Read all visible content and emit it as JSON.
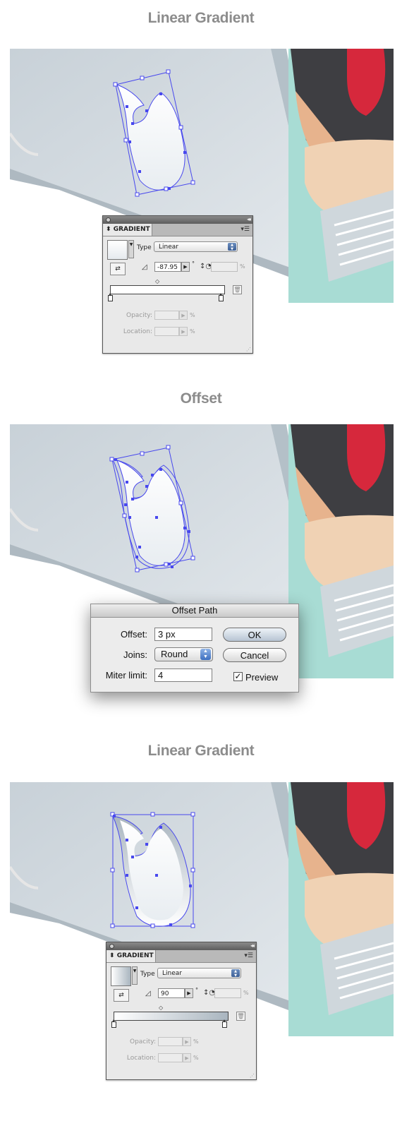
{
  "headings": {
    "first": "Linear Gradient",
    "second": "Offset",
    "third": "Linear Gradient"
  },
  "panel1": {
    "tab_label": "GRADIENT",
    "type_label": "Type",
    "type_value": "Linear",
    "angle_value": "-87.95",
    "degree_symbol": "°",
    "percent_symbol": "%",
    "opacity_label": "Opacity:",
    "location_label": "Location:",
    "gradient_start": "#ffffff",
    "gradient_end": "#ffffff"
  },
  "panel2": {
    "tab_label": "GRADIENT",
    "type_label": "Type",
    "type_value": "Linear",
    "angle_value": "90",
    "degree_symbol": "°",
    "percent_symbol": "%",
    "opacity_label": "Opacity:",
    "location_label": "Location:",
    "gradient_start": "#ffffff",
    "gradient_end": "#a9b5bf"
  },
  "offset_dialog": {
    "title": "Offset Path",
    "offset_label": "Offset:",
    "offset_value": "3 px",
    "joins_label": "Joins:",
    "joins_value": "Round",
    "miter_label": "Miter limit:",
    "miter_value": "4",
    "ok_label": "OK",
    "cancel_label": "Cancel",
    "preview_label": "Preview",
    "preview_checked": true
  },
  "colors": {
    "heading": "#8c8c8c",
    "selection": "#4848ee",
    "screen": "#d3dbe1",
    "laptop_edge": "#a9b5bd",
    "shirt_dark": "#3e3e42",
    "shirt_red": "#d6283c",
    "skin": "#f0d2b4",
    "teal": "#a8dcd4"
  },
  "icons": [
    "close-icon",
    "collapse-icon",
    "panel-menu-icon",
    "swap-icon",
    "angle-icon",
    "aspect-ratio-icon",
    "delete-stop-icon",
    "select-arrows-icon",
    "checkmark-icon",
    "resize-grip-icon"
  ]
}
